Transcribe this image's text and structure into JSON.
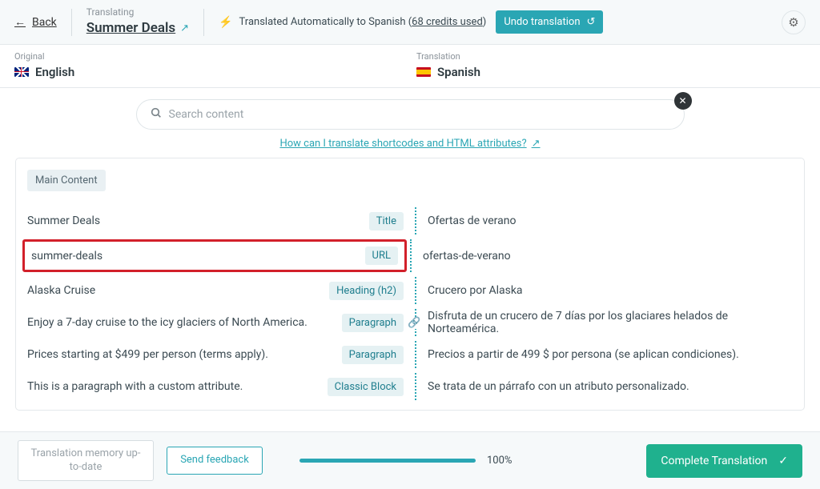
{
  "header": {
    "back_label": "Back",
    "translating_label": "Translating",
    "page_title": "Summer Deals",
    "auto_msg_prefix": "Translated Automatically to Spanish (",
    "credits_link": "68 credits used",
    "auto_msg_suffix": ")",
    "undo_label": "Undo translation"
  },
  "langs": {
    "original_label": "Original",
    "original_name": "English",
    "translation_label": "Translation",
    "translation_name": "Spanish"
  },
  "search": {
    "placeholder": "Search content",
    "help_link": "How can I translate shortcodes and HTML attributes?"
  },
  "section": {
    "title": "Main Content"
  },
  "rows": [
    {
      "src": "Summer Deals",
      "type": "Title",
      "trg": "Ofertas de verano",
      "highlight": false
    },
    {
      "src": "summer-deals",
      "type": "URL",
      "trg": "ofertas-de-verano",
      "highlight": true
    },
    {
      "src": "Alaska Cruise",
      "type": "Heading (h2)",
      "trg": "Crucero por Alaska",
      "highlight": false
    },
    {
      "src": "Enjoy a 7-day cruise to the icy glaciers of North America.",
      "type": "Paragraph",
      "trg": "Disfruta de un crucero de 7 días por los glaciares helados de Norteamérica.",
      "highlight": false
    },
    {
      "src": "Prices starting at $499 per person (terms apply).",
      "type": "Paragraph",
      "trg": "Precios a partir de 499 $ por persona (se aplican condiciones).",
      "highlight": false
    },
    {
      "src": "This is a paragraph with a custom attribute.",
      "type": "Classic Block",
      "trg": "Se trata de un párrafo con un atributo personalizado.",
      "highlight": false
    }
  ],
  "footer": {
    "memory_label": "Translation memory up-to-date",
    "feedback_label": "Send feedback",
    "progress_pct": "100%",
    "complete_label": "Complete Translation"
  }
}
